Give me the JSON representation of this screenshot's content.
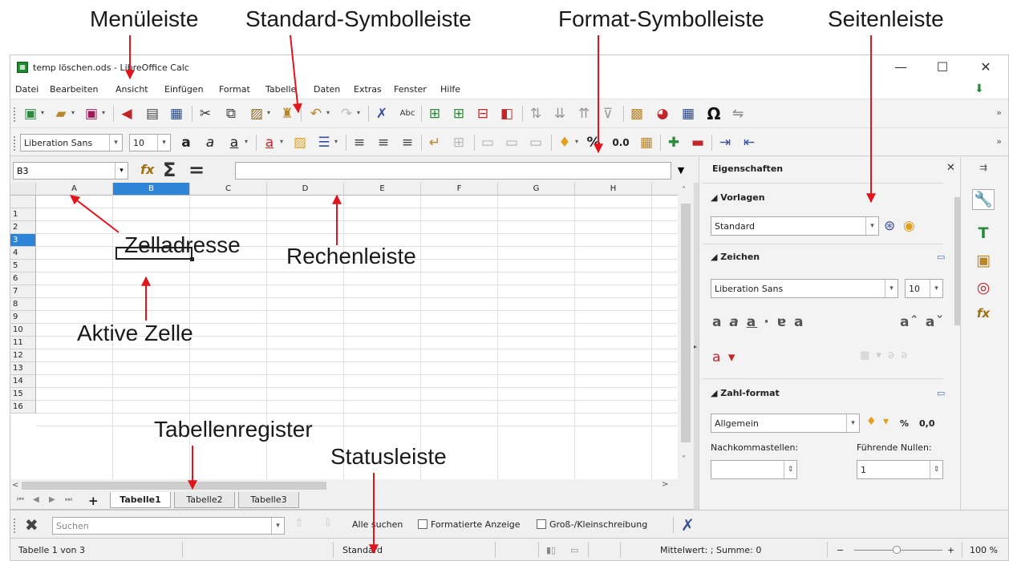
{
  "annotations": {
    "menuleiste": "Menüleiste",
    "standard_symbolleiste": "Standard-Symbolleiste",
    "format_symbolleiste": "Format-Symbolleiste",
    "seitenleiste": "Seitenleiste",
    "zelladresse": "Zelladresse",
    "rechenleiste": "Rechenleiste",
    "aktive_zelle": "Aktive Zelle",
    "tabellenregister": "Tabellenregister",
    "statusleiste": "Statusleiste"
  },
  "window": {
    "title": "temp löschen.ods - LibreOffice Calc",
    "minimize": "—",
    "maximize": "☐",
    "close": "✕"
  },
  "menu": [
    "Datei",
    "Bearbeiten",
    "Ansicht",
    "Einfügen",
    "Format",
    "Tabelle",
    "Daten",
    "Extras",
    "Fenster",
    "Hilfe"
  ],
  "format_toolbar": {
    "font_name": "Liberation Sans",
    "font_size": "10",
    "percent": "%",
    "decimal": "0.0"
  },
  "formula_bar": {
    "name_box": "B3",
    "formula": ""
  },
  "grid": {
    "columns": [
      "A",
      "B",
      "C",
      "D",
      "E",
      "F",
      "G",
      "H"
    ],
    "selected_column": "B",
    "rows": [
      "1",
      "2",
      "3",
      "4",
      "5",
      "6",
      "7",
      "8",
      "9",
      "10",
      "11",
      "12",
      "13",
      "14",
      "15",
      "16"
    ],
    "selected_row": "3"
  },
  "sheet_tabs": {
    "tabs": [
      "Tabelle1",
      "Tabelle2",
      "Tabelle3"
    ],
    "active": "Tabelle1",
    "add": "+"
  },
  "sidebar": {
    "title": "Eigenschaften",
    "close": "✕",
    "vorlagen": {
      "header": "◢ Vorlagen",
      "style": "Standard"
    },
    "zeichen": {
      "header": "◢ Zeichen",
      "font_name": "Liberation Sans",
      "font_size": "10"
    },
    "zahlformat": {
      "header": "◢ Zahl-format",
      "format": "Allgemein",
      "percent": "%",
      "decimal": "0,0",
      "decimals_label": "Nachkommastellen:",
      "leading_zeros_label": "Führende Nullen:",
      "leading_zeros_value": "1"
    }
  },
  "find_toolbar": {
    "placeholder": "Suchen",
    "find_all": "Alle suchen",
    "formatted_display": "Formatierte Anzeige",
    "match_case": "Groß-/Kleinschreibung"
  },
  "status_bar": {
    "sheet": "Tabelle 1 von 3",
    "style": "Standard",
    "summary": "Mittelwert: ; Summe: 0",
    "zoom_minus": "−",
    "zoom_plus": "+",
    "zoom": "100 %"
  }
}
